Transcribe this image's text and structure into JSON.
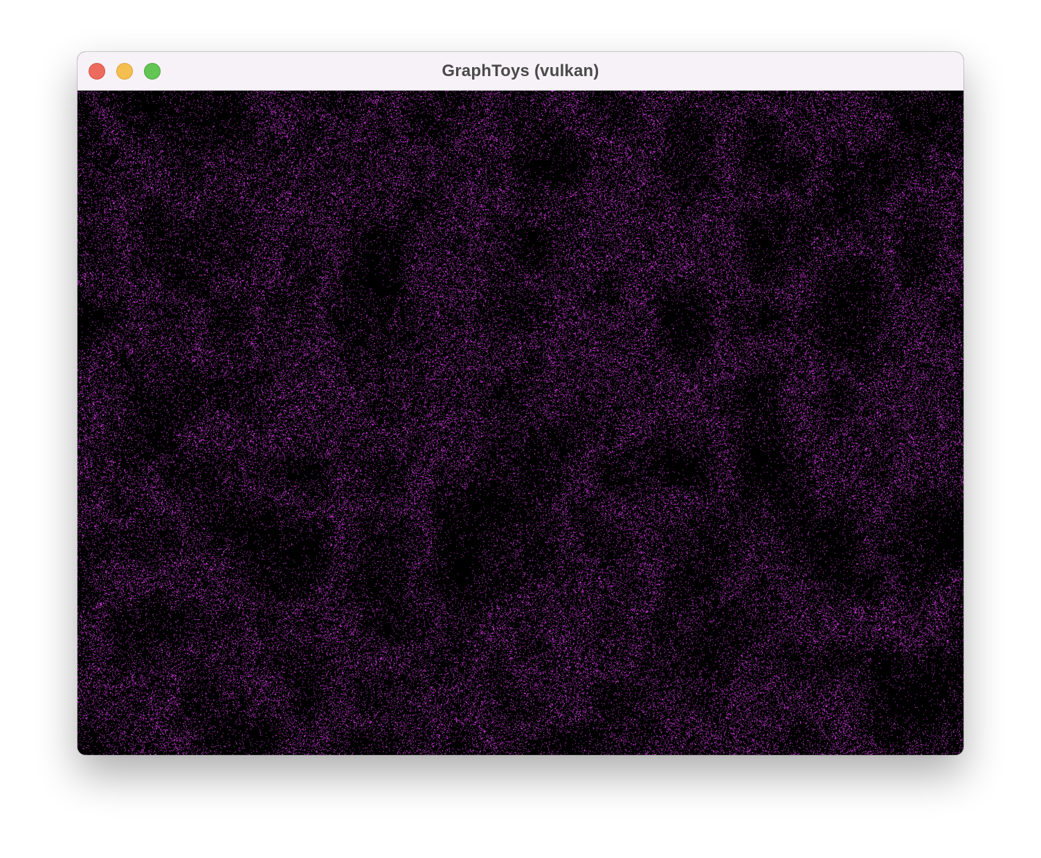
{
  "window": {
    "title": "GraphToys (vulkan)",
    "buttons": [
      {
        "name": "close",
        "color": "#ed6a5e"
      },
      {
        "name": "minimize",
        "color": "#f5bf4f"
      },
      {
        "name": "zoom",
        "color": "#62c554"
      }
    ]
  },
  "viewport": {
    "background_color": "#000000",
    "particle_color": "#d23fe0"
  }
}
